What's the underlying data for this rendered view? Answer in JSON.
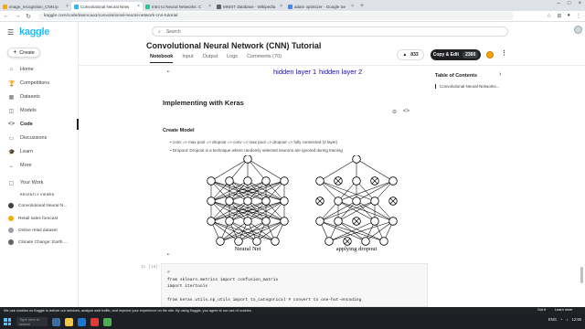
{
  "browser": {
    "tabs": [
      {
        "label": "image_recognition_CNN.ip",
        "color": "#f9ab00"
      },
      {
        "label": "Convolutional Neural Netw",
        "color": "#20beff",
        "active": true
      },
      {
        "label": "Intro to Neural Networks: C",
        "color": "#20c997"
      },
      {
        "label": "MNIST database - Wikipedia",
        "color": "#5f6368"
      },
      {
        "label": "adam optimizer - Google Se",
        "color": "#4285f4"
      }
    ],
    "url": "kaggle.com/code/kanncaa1/convolutional-neural-network-cnn-tutorial"
  },
  "sidebar": {
    "logo": "kaggle",
    "create": "Create",
    "items": [
      {
        "label": "Home",
        "icon": "home-icon",
        "glyph": "⌂"
      },
      {
        "label": "Competitions",
        "icon": "trophy-icon",
        "glyph": "🏆"
      },
      {
        "label": "Datasets",
        "icon": "table-icon",
        "glyph": "▦"
      },
      {
        "label": "Models",
        "icon": "model-icon",
        "glyph": "◫"
      },
      {
        "label": "Code",
        "icon": "code-icon",
        "glyph": "<>",
        "active": true
      },
      {
        "label": "Discussions",
        "icon": "chat-icon",
        "glyph": "▭"
      },
      {
        "label": "Learn",
        "icon": "learn-icon",
        "glyph": "🎓"
      },
      {
        "label": "More",
        "icon": "chevron-down-icon",
        "glyph": "⌄"
      }
    ],
    "your_work": "Your Work",
    "recently_viewed": "RECENTLY VIEWED",
    "recent": [
      {
        "label": "Convolutional Neural N...",
        "color": "#3c4043"
      },
      {
        "label": "Retail sales forecast",
        "color": "#f9ab00"
      },
      {
        "label": "Online retail dataset",
        "color": "#9aa0a6"
      },
      {
        "label": "Climate Change: Earth ...",
        "color": "#5f6368"
      }
    ]
  },
  "header": {
    "search_placeholder": "Search",
    "title": "Convolutional Neural Network (CNN) Tutorial",
    "tabs": [
      "Notebook",
      "Input",
      "Output",
      "Logs",
      "Comments (70)"
    ],
    "votes": "833",
    "copy_edit": "Copy & Edit",
    "copy_count": "2360"
  },
  "notebook": {
    "hidden_layer_1": "hidden layer 1",
    "hidden_layer_2": "hidden layer 2",
    "section": "Implementing with Keras",
    "subsection": "Create Model",
    "bullets": [
      "conv => max pool => dropout => conv => max pool => dropout => fully connected (2 layer)",
      "Dropout: Dropout is a technique where randomly selected neurons are ignored during training"
    ],
    "fig_left": "Neural Net",
    "fig_right": "applying dropout",
    "cell_prompt": "In [19]:",
    "code_lines": [
      {
        "type": "comment",
        "text": "#"
      },
      {
        "type": "code",
        "text": "from sklearn.metrics import confusion_matrix"
      },
      {
        "type": "code",
        "text": "import itertools"
      },
      {
        "type": "blank",
        "text": ""
      },
      {
        "type": "code",
        "text": "from keras.utils.np_utils import to_categorical # convert to one-hot-encoding"
      }
    ]
  },
  "toc": {
    "title": "Table of Contents",
    "item": "Convolutional Neural Networks..."
  },
  "cookie": {
    "text": "We use cookies on Kaggle to deliver our services, analyze web traffic, and improve your experience on the site. By using Kaggle, you agree to our use of cookies.",
    "ok": "Got it",
    "learn": "Learn more"
  },
  "taskbar": {
    "search": "Type here to search",
    "lang": "ENG",
    "time": "12:55"
  }
}
